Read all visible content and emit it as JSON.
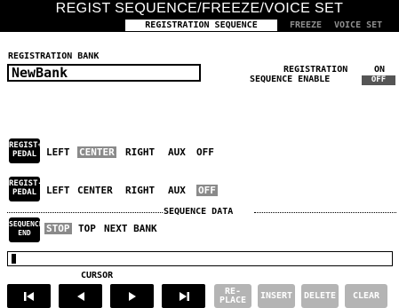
{
  "header": {
    "title": "REGIST SEQUENCE/FREEZE/VOICE SET"
  },
  "tabs": [
    {
      "label": "REGISTRATION SEQUENCE"
    },
    {
      "label": "FREEZE"
    },
    {
      "label": "VOICE SET"
    }
  ],
  "bank": {
    "label": "REGISTRATION BANK",
    "value": "NewBank"
  },
  "enable": {
    "label_line1": "REGISTRATION",
    "label_line2": "SEQUENCE ENABLE",
    "on": "ON",
    "off": "OFF"
  },
  "pedal_plus": {
    "button_line1": "REGIST+",
    "button_line2": "PEDAL",
    "options": [
      "LEFT",
      "CENTER",
      "RIGHT",
      "AUX",
      "OFF"
    ],
    "selected": "CENTER"
  },
  "pedal_minus": {
    "button_line1": "REGIST-",
    "button_line2": "PEDAL",
    "options": [
      "LEFT",
      "CENTER",
      "RIGHT",
      "AUX",
      "OFF"
    ],
    "selected": "OFF"
  },
  "sequence": {
    "data_label": "SEQUENCE DATA",
    "end_line1": "SEQUENCE",
    "end_line2": "END",
    "options": [
      "STOP",
      "TOP",
      "NEXT BANK"
    ],
    "selected": "STOP"
  },
  "cursor": {
    "label": "CURSOR"
  },
  "buttons": {
    "replace_line1": "RE-",
    "replace_line2": "PLACE",
    "insert": "INSERT",
    "delete": "DELETE",
    "clear": "CLEAR"
  },
  "icons": {
    "first": "skip-to-start-icon",
    "left": "left-arrow-icon",
    "right": "right-arrow-icon",
    "last": "skip-to-end-icon"
  },
  "colors": {
    "background": "#ffffff",
    "foreground": "#000000",
    "selected_chip": "#8a8a8a",
    "disabled_button": "#b4b4b4"
  }
}
